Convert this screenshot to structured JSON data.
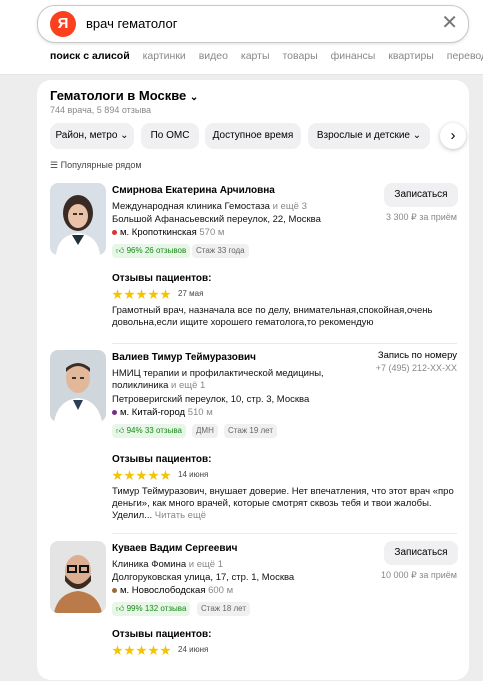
{
  "search": {
    "query": "врач гематолог",
    "logo_letter": "Я"
  },
  "tabs": [
    "поиск с алисой",
    "картинки",
    "видео",
    "карты",
    "товары",
    "финансы",
    "квартиры",
    "переводчик"
  ],
  "header": {
    "title": "Гематологи в Москве",
    "subtitle": "744 врача, 5 894 отзыва"
  },
  "filters": [
    "Район, метро ⌄",
    "По ОМС",
    "Доступное время",
    "Взрослые и детские ⌄"
  ],
  "sort_label": "Популярные рядом",
  "reviews_title": "Отзывы пациентов:",
  "doctors": [
    {
      "name": "Смирнова Екатерина Арчиловна",
      "clinic": "Международная клиника Гемостаза",
      "clinic_more": "и ещё 3",
      "address": "Большой Афанасьевский переулок, 22, Москва",
      "metro": "м. Кропоткинская",
      "metro_dist": "570 м",
      "rating": "96%",
      "reviews_count": "26 отзывов",
      "experience": "Стаж 33 года",
      "action": "Записаться",
      "price": "3 300 ₽ за приём",
      "review_stars": 5,
      "review_date": "27 мая",
      "review_text": "Грамотный врач, назначала все по делу, внимательная,спокойная,очень довольна,если ищите хорошего гематолога,то рекомендую"
    },
    {
      "name": "Валиев Тимур Теймуразович",
      "clinic": "НМИЦ терапии и профилактической медицины, поликлиника",
      "clinic_line1": "НМИЦ терапии и профилактической медицины,",
      "clinic_line2": "поликлиника",
      "clinic_more": "и ещё 1",
      "address": "Петроверигский переулок, 10, стр. 3, Москва",
      "metro": "м. Китай-город",
      "metro_dist": "510 м",
      "rating": "94%",
      "reviews_count": "33 отзыва",
      "tag": "ДМН",
      "experience": "Стаж 19 лет",
      "action": "Запись по номеру",
      "phone": "+7 (495) 212-XX-XX",
      "review_stars": 5,
      "review_date": "14 июня",
      "review_text": "Тимур Теймуразович, внушает доверие. Нет впечатления, что этот врач «про деньги», как много врачей, которые смотрят сквозь тебя и твои жалобы. Уделил...",
      "read_more": "Читать ещё"
    },
    {
      "name": "Куваев Вадим Сергеевич",
      "clinic": "Клиника Фомина",
      "clinic_more": "и ещё 1",
      "address": "Долгоруковская улица, 17, стр. 1, Москва",
      "metro": "м. Новослободская",
      "metro_dist": "600 м",
      "rating": "99%",
      "reviews_count": "132 отзыва",
      "experience": "Стаж 18 лет",
      "action": "Записаться",
      "price": "10 000 ₽ за приём",
      "review_stars": 5,
      "review_date": "24 июня"
    }
  ]
}
